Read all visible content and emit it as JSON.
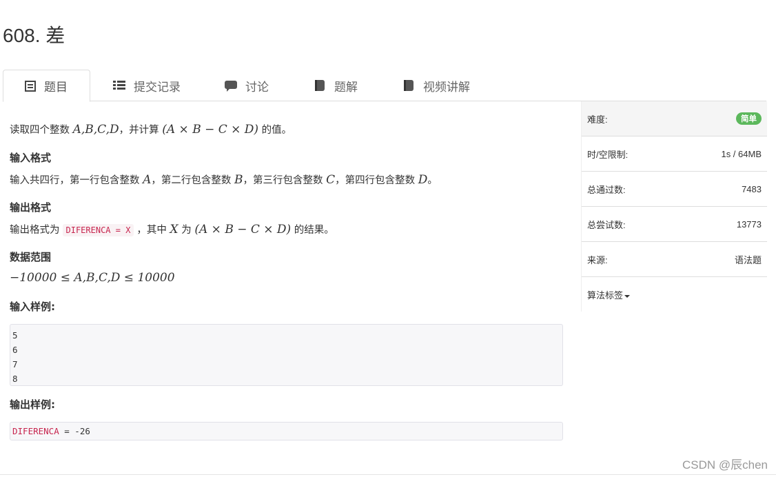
{
  "title": {
    "number": "608.",
    "name": "差"
  },
  "tabs": [
    {
      "label": "题目",
      "icon": "list-alt-icon",
      "active": true
    },
    {
      "label": "提交记录",
      "icon": "list-icon",
      "active": false
    },
    {
      "label": "讨论",
      "icon": "comment-icon",
      "active": false
    },
    {
      "label": "题解",
      "icon": "book-icon",
      "active": false
    },
    {
      "label": "视频讲解",
      "icon": "book-icon",
      "active": false
    }
  ],
  "problem": {
    "desc_prefix": "读取四个整数 ",
    "desc_vars": "A,B,C,D",
    "desc_mid": "，并计算 ",
    "desc_expr": "(A × B − C × D)",
    "desc_suffix": " 的值。",
    "input_heading": "输入格式",
    "input_text_1": "输入共四行，第一行包含整数 ",
    "input_var_1": "A",
    "input_text_2": "，第二行包含整数 ",
    "input_var_2": "B",
    "input_text_3": "，第三行包含整数 ",
    "input_var_3": "C",
    "input_text_4": "，第四行包含整数 ",
    "input_var_4": "D",
    "input_text_5": "。",
    "output_heading": "输出格式",
    "output_text_1": "输出格式为",
    "output_code": "DIFERENCA = X",
    "output_text_2": "，其中 ",
    "output_var": "X",
    "output_text_3": " 为 ",
    "output_expr": "(A × B − C × D)",
    "output_text_4": " 的结果。",
    "range_heading": "数据范围",
    "range_text": "−10000 ≤ A,B,C,D ≤ 10000",
    "sample_in_heading": "输入样例:",
    "sample_in": "5\n6\n7\n8",
    "sample_out_heading": "输出样例:",
    "sample_out_keyword": "DIFERENCA",
    "sample_out_rest": " = -26"
  },
  "sidebar": {
    "difficulty_label": "难度:",
    "difficulty_value": "简单",
    "limit_label": "时/空限制:",
    "limit_value": "1s / 64MB",
    "passed_label": "总通过数:",
    "passed_value": "7483",
    "tried_label": "总尝试数:",
    "tried_value": "13773",
    "source_label": "来源:",
    "source_value": "语法题",
    "tags_label": "算法标签"
  },
  "watermark": "CSDN @辰chen",
  "colors": {
    "badge": "#5cb85c",
    "code_red": "#c7254e"
  }
}
